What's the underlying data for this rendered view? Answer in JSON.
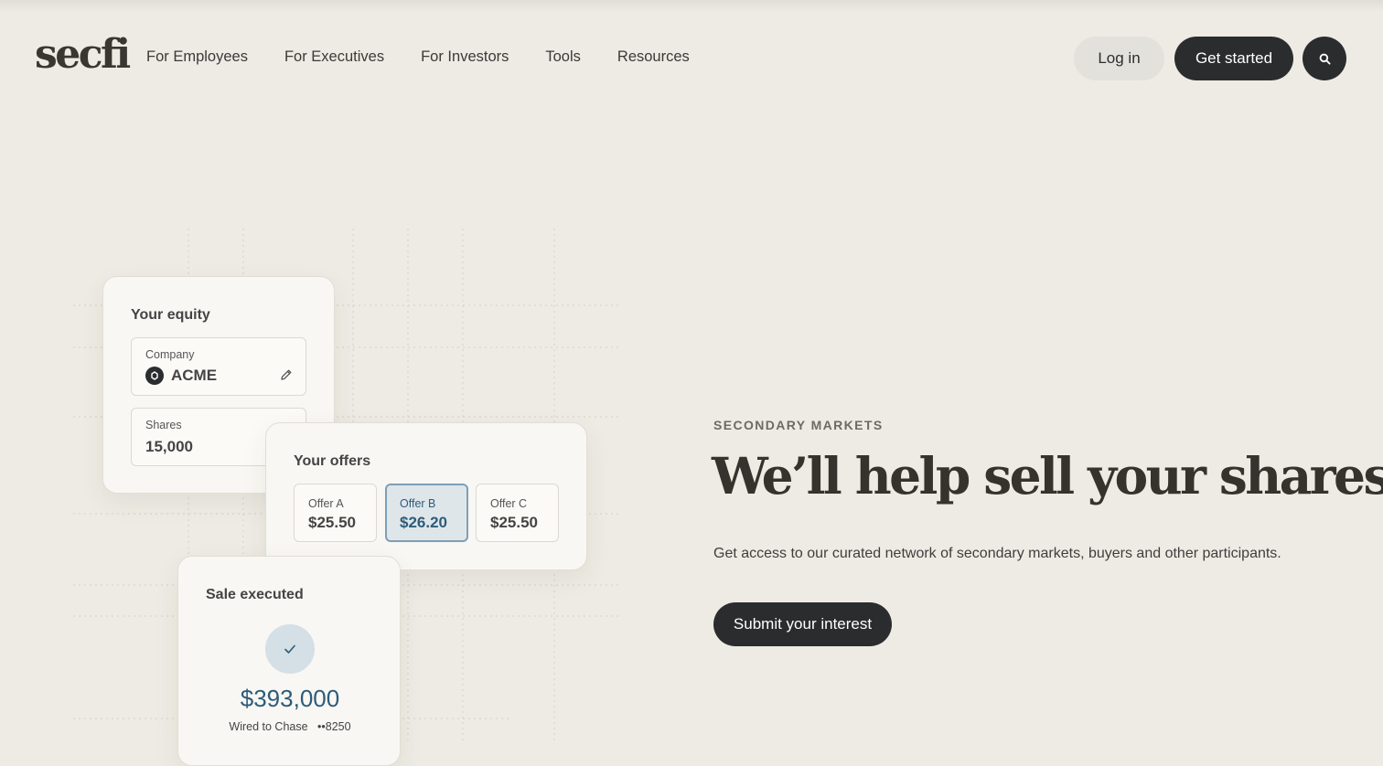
{
  "header": {
    "logo": "secfi",
    "nav": [
      {
        "label": "For Employees"
      },
      {
        "label": "For Executives"
      },
      {
        "label": "For Investors"
      },
      {
        "label": "Tools"
      },
      {
        "label": "Resources"
      }
    ],
    "login_label": "Log in",
    "get_started_label": "Get started",
    "search_icon": "search-icon"
  },
  "equity_card": {
    "title": "Your equity",
    "company_label": "Company",
    "company_value": "ACME",
    "shares_label": "Shares",
    "shares_value": "15,000"
  },
  "offers_card": {
    "title": "Your offers",
    "offers": [
      {
        "label": "Offer A",
        "price": "$25.50"
      },
      {
        "label": "Offer B",
        "price": "$26.20",
        "selected": true
      },
      {
        "label": "Offer C",
        "price": "$25.50"
      }
    ]
  },
  "sale_card": {
    "title": "Sale executed",
    "amount": "$393,000",
    "note": "Wired to Chase",
    "account": "••8250"
  },
  "hero": {
    "eyebrow": "SECONDARY MARKETS",
    "headline": "We’ll help sell your shares",
    "subtext": "Get access to our curated network of secondary markets, buyers and other participants.",
    "cta_label": "Submit your interest"
  },
  "colors": {
    "background": "#eeebe4",
    "dark_button": "#2a2c2e",
    "accent_blue": "#2d5c7a",
    "selected_offer_bg": "#dfe6ea"
  }
}
